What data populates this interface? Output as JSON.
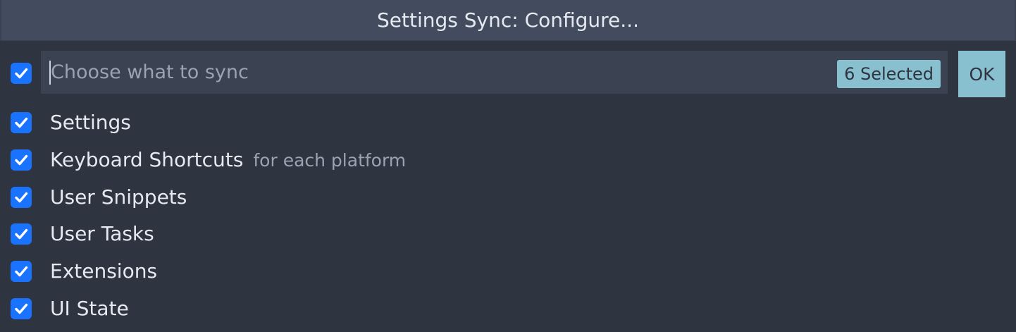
{
  "title": "Settings Sync: Configure...",
  "input": {
    "placeholder": "Choose what to sync",
    "value": "",
    "select_all_checked": true,
    "badge": "6 Selected"
  },
  "ok_label": "OK",
  "items": [
    {
      "label": "Settings",
      "description": "",
      "checked": true
    },
    {
      "label": "Keyboard Shortcuts",
      "description": "for each platform",
      "checked": true
    },
    {
      "label": "User Snippets",
      "description": "",
      "checked": true
    },
    {
      "label": "User Tasks",
      "description": "",
      "checked": true
    },
    {
      "label": "Extensions",
      "description": "",
      "checked": true
    },
    {
      "label": "UI State",
      "description": "",
      "checked": true
    }
  ],
  "colors": {
    "background": "#2e3440",
    "title_bar": "#434c5e",
    "input_bg": "#3b4252",
    "accent": "#88c0d0",
    "checkbox": "#1a73ff"
  },
  "icons": {
    "checkbox": "check-icon"
  }
}
